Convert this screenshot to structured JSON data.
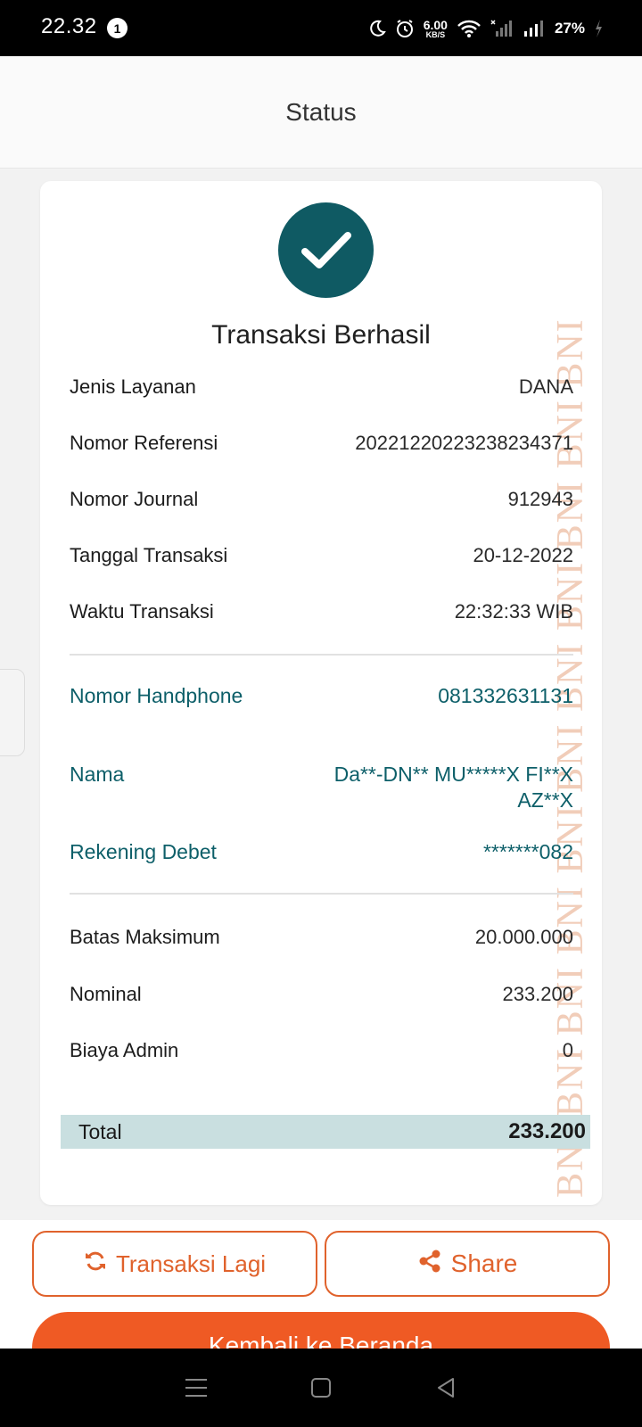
{
  "status_bar": {
    "time": "22.32",
    "notification_count": "1",
    "net_speed_value": "6.00",
    "net_speed_unit": "KB/S",
    "battery": "27%"
  },
  "header": {
    "title": "Status"
  },
  "card": {
    "success_title": "Transaksi Berhasil",
    "watermark": "BNI BNI BNI BNI BNI BNI BNI BNI BNI BNI BNI",
    "details": [
      {
        "label": "Jenis Layanan",
        "value": "DANA"
      },
      {
        "label": "Nomor Referensi",
        "value": "20221220223238234371"
      },
      {
        "label": "Nomor Journal",
        "value": "912943"
      },
      {
        "label": "Tanggal Transaksi",
        "value": "20-12-2022"
      },
      {
        "label": "Waktu Transaksi",
        "value": "22:32:33 WIB"
      }
    ],
    "recipient": [
      {
        "label": "Nomor Handphone",
        "value": "081332631131"
      },
      {
        "label": "Nama",
        "value": "Da**-DN** MU*****X FI**X AZ**X"
      },
      {
        "label": "Rekening Debet",
        "value": "*******082"
      }
    ],
    "amounts": [
      {
        "label": "Batas Maksimum",
        "value": "20.000.000"
      },
      {
        "label": "Nominal",
        "value": "233.200"
      },
      {
        "label": "Biaya Admin",
        "value": "0"
      }
    ],
    "total": {
      "label": "Total",
      "value": "233.200"
    }
  },
  "actions": {
    "again_label": "Transaksi Lagi",
    "share_label": "Share",
    "primary_label": "Kembali ke Beranda"
  },
  "colors": {
    "teal": "#0f5a63",
    "orange": "#ef5a24",
    "total_bg": "#c9dfe0"
  }
}
